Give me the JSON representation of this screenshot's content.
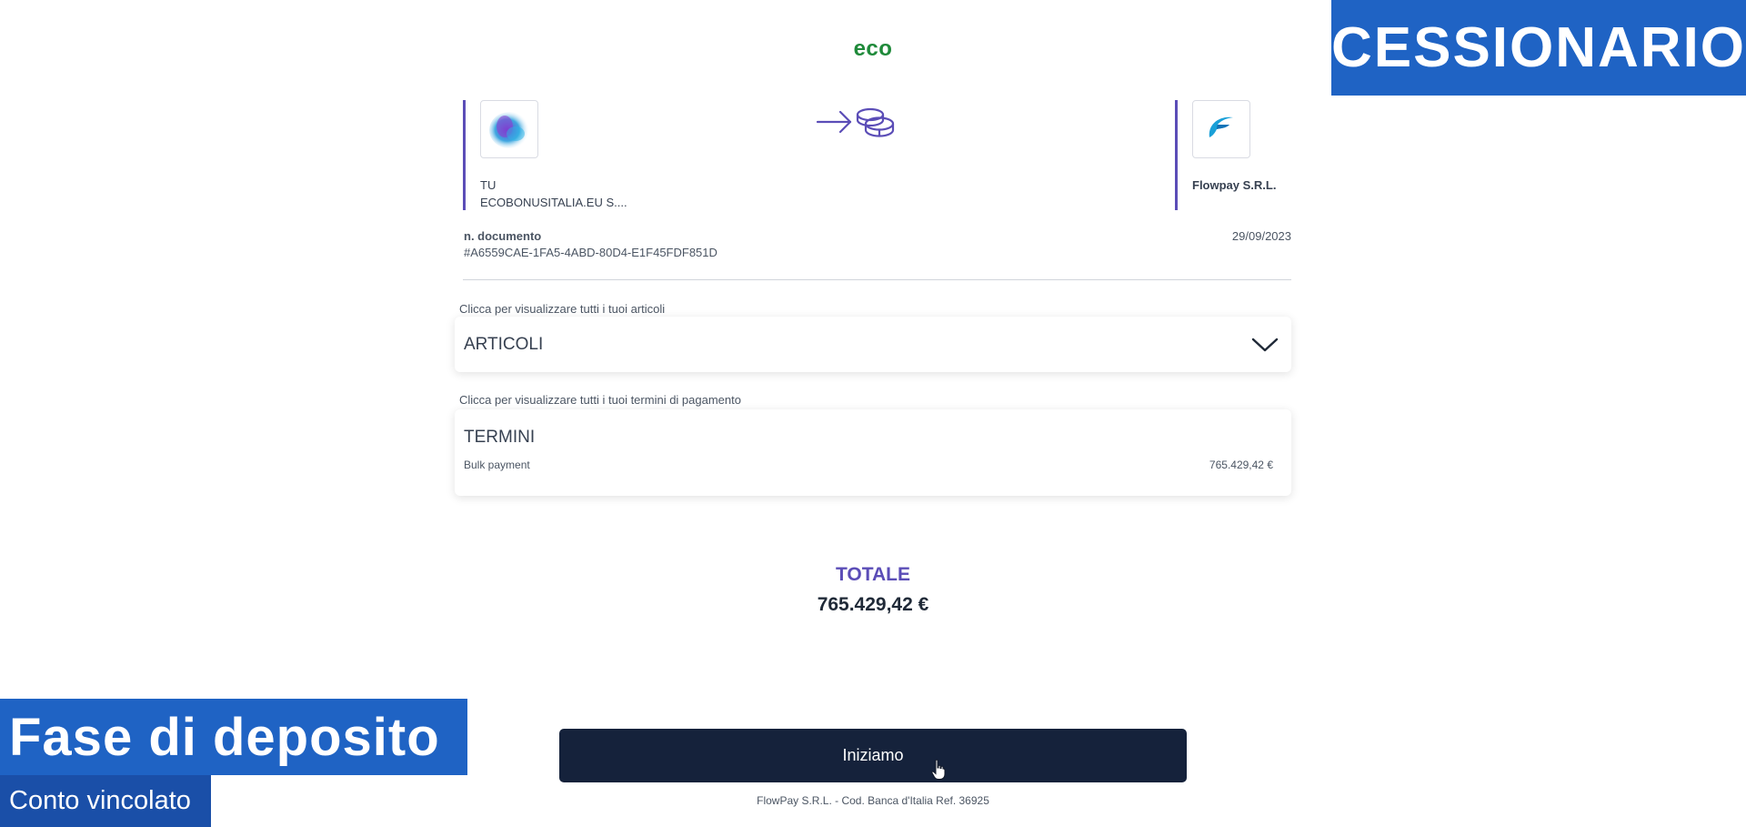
{
  "header": {
    "brand": "eco"
  },
  "overlays": {
    "corner_tag": "CESSIONARIO",
    "phase": "Fase di deposito",
    "subphase": "Conto vincolato"
  },
  "parties": {
    "sender_label": "TU",
    "sender_name": "ECOBONUSITALIA.EU S....",
    "receiver_name": "Flowpay S.R.L."
  },
  "document": {
    "label": "n. documento",
    "number": "#A6559CAE-1FA5-4ABD-80D4-E1F45FDF851D",
    "date": "29/09/2023"
  },
  "articles": {
    "hint": "Clicca per visualizzare tutti i tuoi articoli",
    "title": "ARTICOLI"
  },
  "terms": {
    "hint": "Clicca per visualizzare tutti i tuoi termini di pagamento",
    "title": "TERMINI",
    "row_label": "Bulk payment",
    "row_amount": "765.429,42 €"
  },
  "total": {
    "label": "TOTALE",
    "value": "765.429,42 €"
  },
  "cta": {
    "label": "Iniziamo"
  },
  "footer": {
    "text": "FlowPay S.R.L. - Cod. Banca d'Italia Ref. 36925"
  },
  "colors": {
    "accent": "#5b4db7",
    "brand_green": "#1f8a3a",
    "tag_blue": "#1f63c4",
    "cta_dark": "#15223b"
  },
  "icons": {
    "sender_avatar": "ecobonus-logo-icon",
    "receiver_avatar": "flowpay-logo-icon",
    "transfer": "arrow-coins-icon",
    "expand": "chevron-down-icon",
    "cursor": "hand-pointer-icon"
  }
}
